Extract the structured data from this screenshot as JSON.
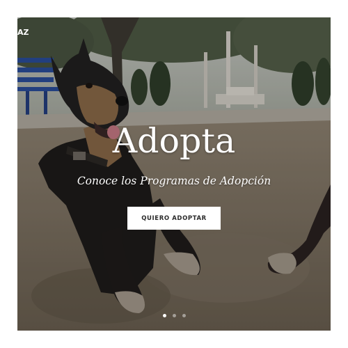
{
  "brand": {
    "logo_text": "AZ"
  },
  "hero": {
    "title": "Adopta",
    "subtitle": "Conoce los Programas de Adopción",
    "cta_label": "QUIERO ADOPTAR",
    "slide_count": 3,
    "active_slide": 1
  },
  "colors": {
    "overlay": "#000000",
    "cta_background": "#ffffff",
    "cta_text": "#2b2b2b",
    "text": "#ffffff"
  }
}
